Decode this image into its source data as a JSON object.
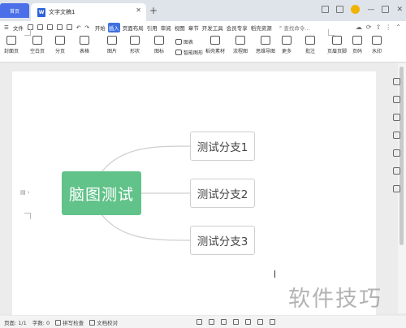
{
  "tabs": {
    "home_label": "首页",
    "doc_icon_label": "W",
    "doc_title": "文字文稿1"
  },
  "menu": {
    "file_label": "文件",
    "items": [
      "开始",
      "插入",
      "页面布局",
      "引用",
      "审阅",
      "视图",
      "章节",
      "开发工具",
      "会员专享",
      "稻壳资源"
    ],
    "active_index": 1,
    "search_placeholder": "查找命令..."
  },
  "ribbon": {
    "buttons": [
      "封面页",
      "空白页",
      "分页",
      "表格",
      "图片",
      "形状",
      "图标",
      "稻壳素材",
      "流程图",
      "思维导图",
      "更多",
      "批注",
      "页眉页脚",
      "页码",
      "水印"
    ],
    "small": [
      "图表",
      "智能图形"
    ]
  },
  "mindmap": {
    "root": "脑图测试",
    "branches": [
      "测试分支1",
      "测试分支2",
      "测试分支3"
    ]
  },
  "status": {
    "page": "页面: 1/1",
    "words": "字数: 0",
    "spell": "拼写检查",
    "proofread": "文档校对"
  },
  "watermark": "软件技巧",
  "colors": {
    "accent": "#3f6fe0",
    "home_tab": "#4a6fe8",
    "root_node": "#62c38a"
  }
}
